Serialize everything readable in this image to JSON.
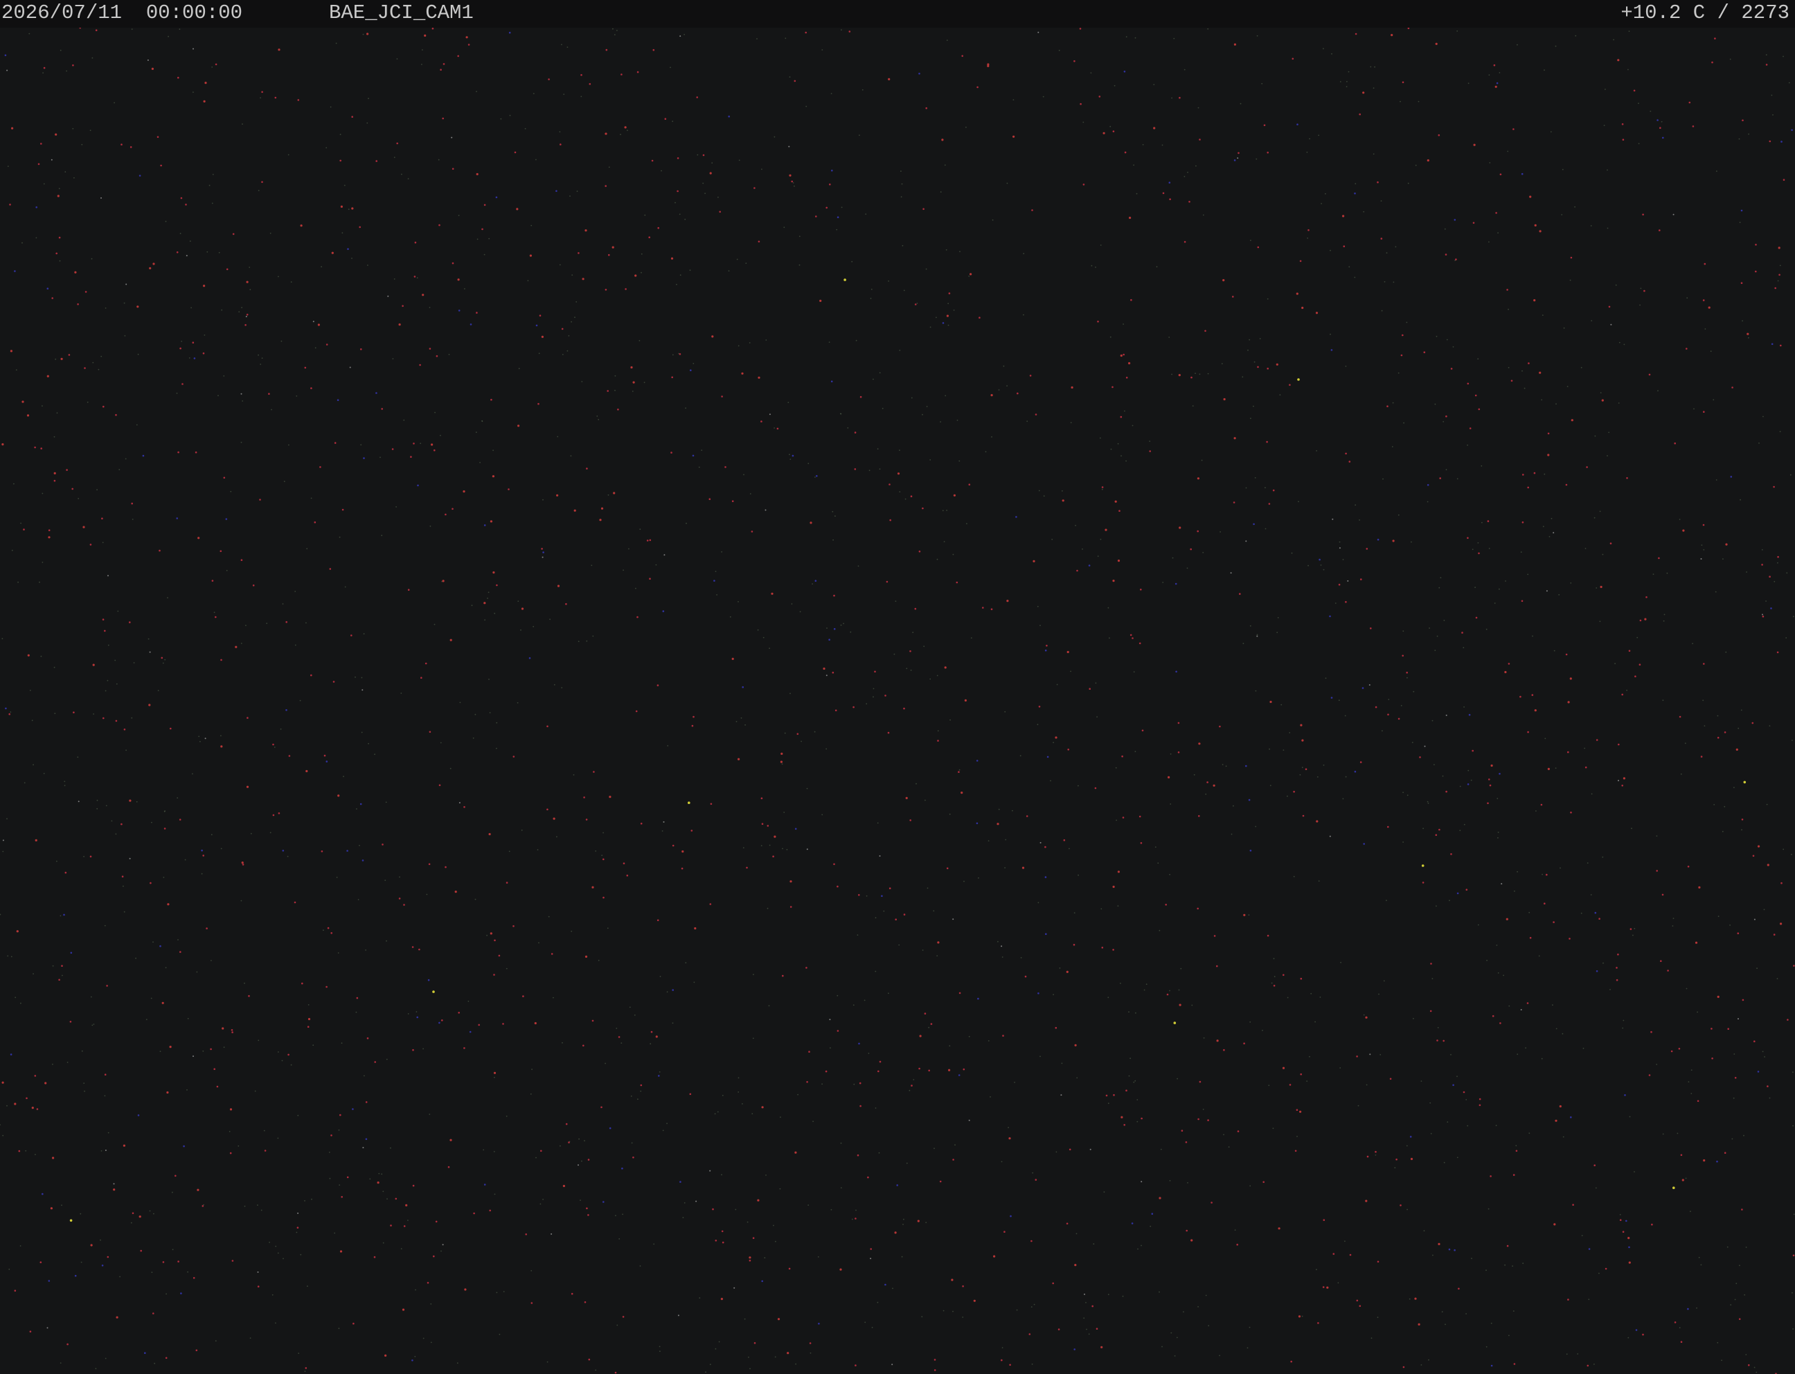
{
  "overlay": {
    "timestamp": "2026/07/11  00:00:00",
    "camera_id": "BAE_JCI_CAM1",
    "sensor_readout": "+10.2 C / 2273"
  },
  "image": {
    "subject": "night-sky-star-field",
    "background_color": "#141516",
    "star_colors": [
      "#e0344a",
      "#d23c3c",
      "#5a6a52",
      "#3c3fd8",
      "#c8c8c8",
      "#e6e13a"
    ]
  }
}
